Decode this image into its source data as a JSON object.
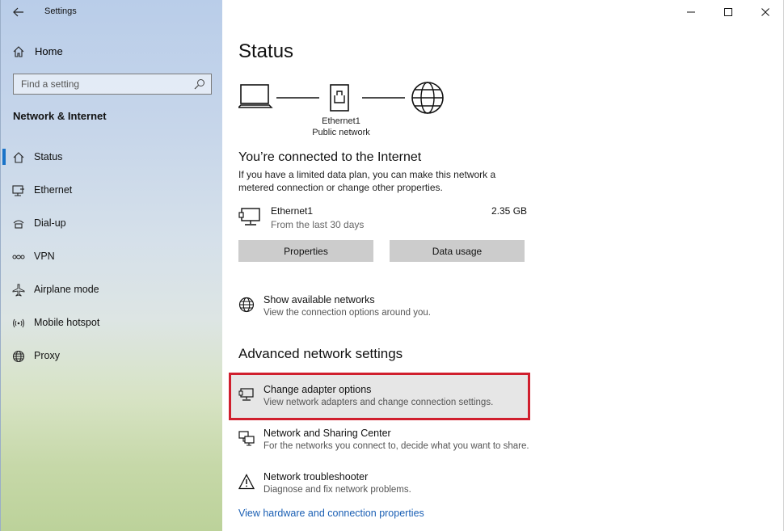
{
  "window": {
    "title": "Settings"
  },
  "sidebar": {
    "home_label": "Home",
    "search_placeholder": "Find a setting",
    "section_title": "Network & Internet",
    "items": [
      {
        "label": "Status",
        "icon": "home-status-icon"
      },
      {
        "label": "Ethernet",
        "icon": "ethernet-icon"
      },
      {
        "label": "Dial-up",
        "icon": "dialup-icon"
      },
      {
        "label": "VPN",
        "icon": "vpn-icon"
      },
      {
        "label": "Airplane mode",
        "icon": "airplane-icon"
      },
      {
        "label": "Mobile hotspot",
        "icon": "hotspot-icon"
      },
      {
        "label": "Proxy",
        "icon": "globe-icon"
      }
    ],
    "active_index": 0,
    "accent": "#1a73c8"
  },
  "main": {
    "title": "Status",
    "diagram": {
      "adapter_name": "Ethernet1",
      "network_type": "Public network"
    },
    "connected": {
      "title": "You’re connected to the Internet",
      "description": "If you have a limited data plan, you can make this network a metered connection or change other properties."
    },
    "usage": {
      "name": "Ethernet1",
      "period": "From the last 30 days",
      "amount": "2.35 GB"
    },
    "buttons": {
      "properties": "Properties",
      "data_usage": "Data usage"
    },
    "show_networks": {
      "title": "Show available networks",
      "subtitle": "View the connection options around you."
    },
    "advanced_title": "Advanced network settings",
    "advanced": [
      {
        "title": "Change adapter options",
        "subtitle": "View network adapters and change connection settings.",
        "highlighted": true
      },
      {
        "title": "Network and Sharing Center",
        "subtitle": "For the networks you connect to, decide what you want to share."
      },
      {
        "title": "Network troubleshooter",
        "subtitle": "Diagnose and fix network problems."
      }
    ],
    "bottom_link": "View hardware and connection properties"
  },
  "colors": {
    "highlight_border": "#d01f2e",
    "link": "#1a5fb4"
  }
}
